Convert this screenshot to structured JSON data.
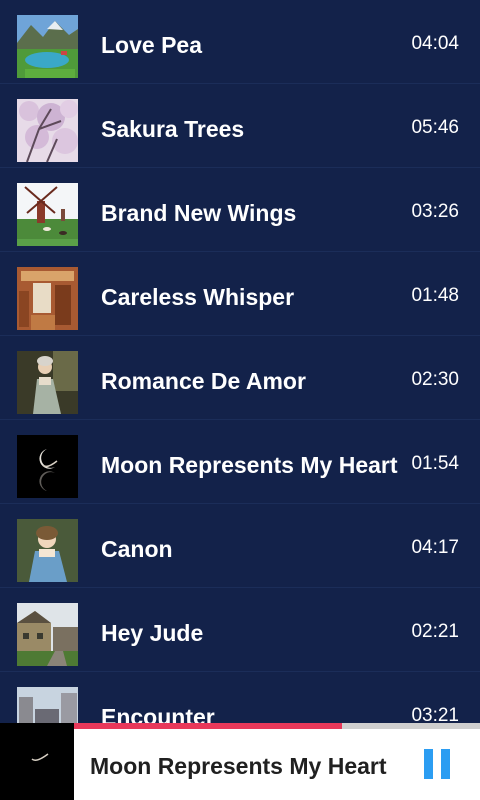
{
  "songs": [
    {
      "title": "Love Pea",
      "duration": "04:04",
      "thumbnail": "lake-landscape-thumbnail"
    },
    {
      "title": "Sakura Trees",
      "duration": "05:46",
      "thumbnail": "cherry-blossom-thumbnail"
    },
    {
      "title": "Brand New Wings",
      "duration": "03:26",
      "thumbnail": "windmill-field-thumbnail"
    },
    {
      "title": "Careless Whisper",
      "duration": "01:48",
      "thumbnail": "wooden-interior-thumbnail"
    },
    {
      "title": "Romance De Amor",
      "duration": "02:30",
      "thumbnail": "portrait-painting-thumbnail"
    },
    {
      "title": "Moon Represents My Heart",
      "duration": "01:54",
      "thumbnail": "crescent-moon-thumbnail"
    },
    {
      "title": "Canon",
      "duration": "04:17",
      "thumbnail": "lady-portrait-thumbnail"
    },
    {
      "title": "Hey Jude",
      "duration": "02:21",
      "thumbnail": "village-street-thumbnail"
    },
    {
      "title": "Encounter",
      "duration": "03:21",
      "thumbnail": "city-street-thumbnail"
    }
  ],
  "player": {
    "title": "Moon Represents My Heart",
    "progress": 0.66,
    "artwork": "crescent-moon-artwork",
    "pause_icon": "pause-icon",
    "accent_color": "#2b9df2",
    "progress_color": "#e8385a"
  },
  "colors": {
    "background": "#13224a",
    "text": "#ffffff"
  }
}
